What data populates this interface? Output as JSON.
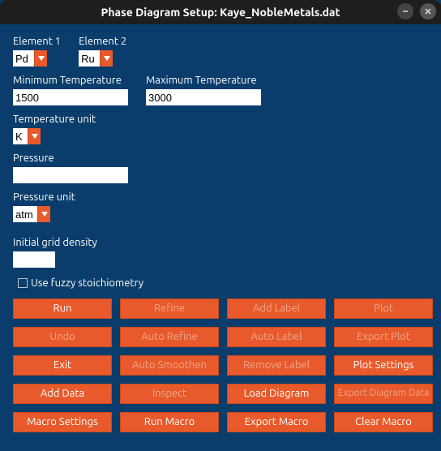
{
  "window": {
    "title": "Phase Diagram Setup: Kaye_NobleMetals.dat"
  },
  "elements": {
    "label1": "Element 1",
    "label2": "Element 2",
    "value1": "Pd",
    "value2": "Ru"
  },
  "temperature": {
    "min_label": "Minimum Temperature",
    "max_label": "Maximum Temperature",
    "min_value": "1500",
    "max_value": "3000",
    "unit_label": "Temperature unit",
    "unit_value": "K"
  },
  "pressure": {
    "label": "Pressure",
    "value": "",
    "unit_label": "Pressure unit",
    "unit_value": "atm"
  },
  "grid": {
    "label": "Initial grid density",
    "value": ""
  },
  "fuzzy": {
    "label": "Use fuzzy stoichiometry",
    "checked": false
  },
  "buttons": {
    "run": "Run",
    "refine": "Refine",
    "add_label": "Add Label",
    "plot": "Plot",
    "undo": "Undo",
    "auto_refine": "Auto Refine",
    "auto_label": "Auto Label",
    "export_plot": "Export Plot",
    "exit": "Exit",
    "auto_smoothen": "Auto Smoothen",
    "remove_label": "Remove Label",
    "plot_settings": "Plot Settings",
    "add_data": "Add Data",
    "inspect": "Inspect",
    "load_diagram": "Load Diagram",
    "export_diagram_data": "Export Diagram Data",
    "macro_settings": "Macro Settings",
    "run_macro": "Run Macro",
    "export_macro": "Export Macro",
    "clear_macro": "Clear Macro"
  }
}
